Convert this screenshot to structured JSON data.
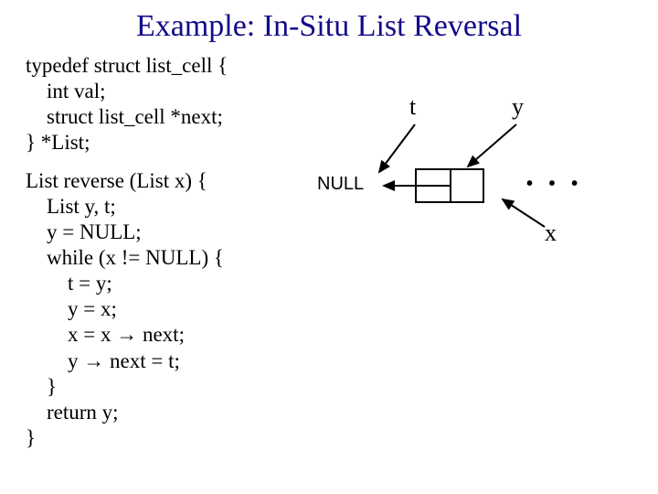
{
  "title": "Example: In-Situ List Reversal",
  "typedef": {
    "l1": "typedef struct list_cell {",
    "l2": "    int val;",
    "l3": "    struct list_cell *next;",
    "l4": "} *List;"
  },
  "func": {
    "l1": "List reverse (List x) {",
    "l2": "    List y, t;",
    "l3": "    y = NULL;",
    "l4": "    while (x != NULL) {",
    "l5": "        t = y;",
    "l6": "        y = x;",
    "l7": "        x = x → next;",
    "l8": "        y → next = t;",
    "l9": "    }",
    "l10": "    return y;",
    "l11": "}"
  },
  "diagram": {
    "t_label": "t",
    "y_label": "y",
    "x_label": "x",
    "null_label": "NULL",
    "dots": "• • •"
  }
}
